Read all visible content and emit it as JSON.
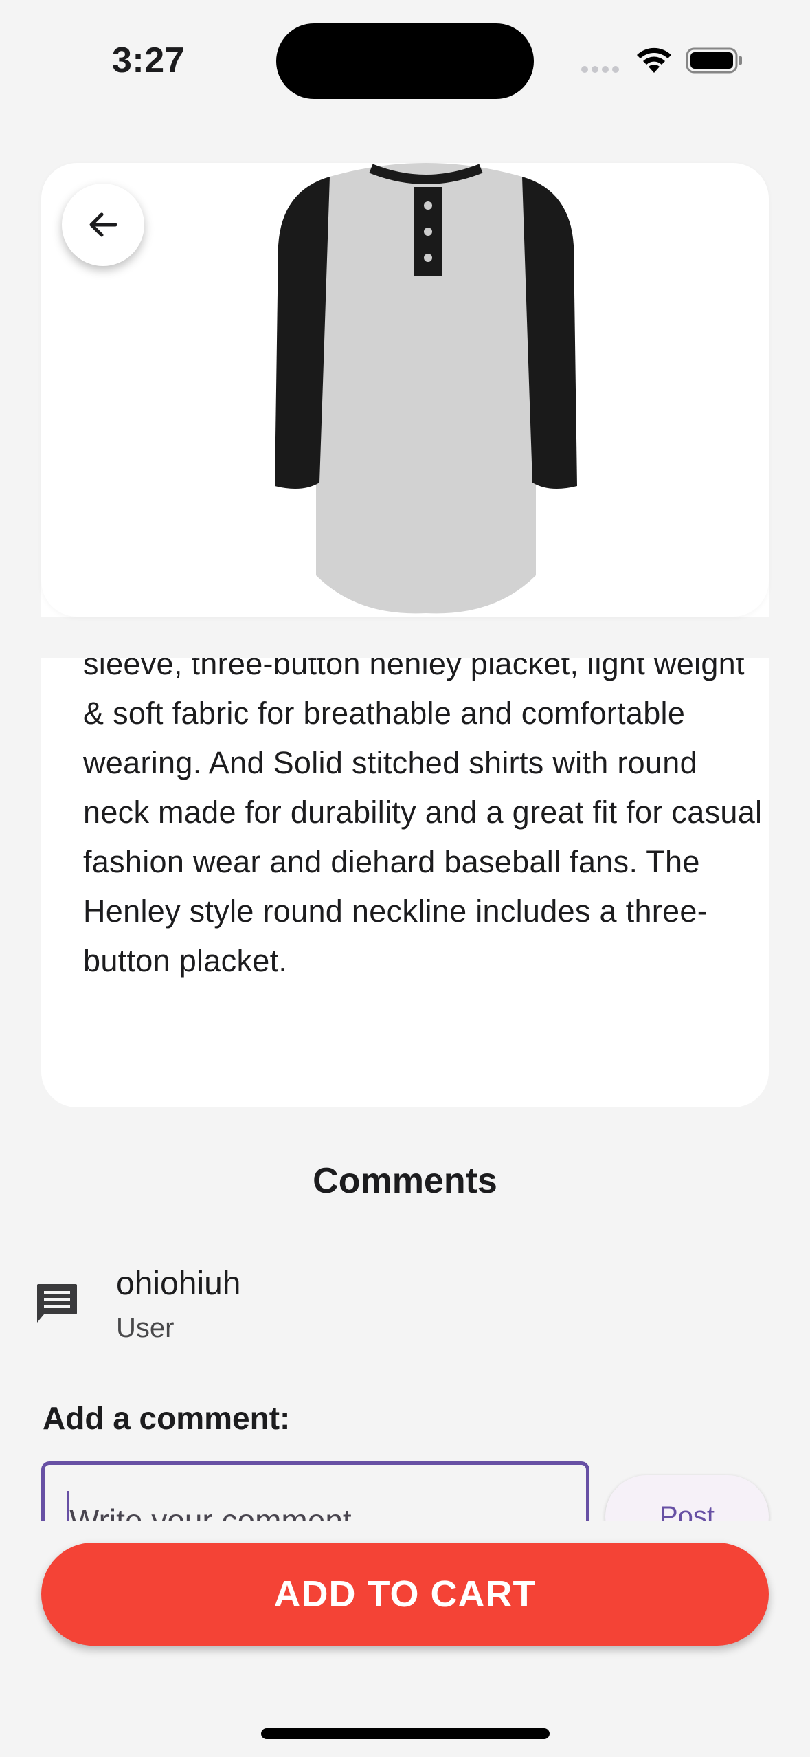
{
  "status_bar": {
    "time": "3:27"
  },
  "product": {
    "image_alt": "Henley raglan shirt",
    "description": "sleeve, three-button henley placket, light weight & soft fabric for breathable and comfortable wearing. And Solid stitched shirts with round neck made for durability and a great fit for casual fashion wear and diehard baseball fans. The Henley style round neckline includes a three-button placket."
  },
  "comments": {
    "heading": "Comments",
    "items": [
      {
        "text": "ohiohiuh",
        "author": "User"
      }
    ],
    "add_label": "Add a comment:",
    "input_placeholder": "Write your comment",
    "post_label": "Post"
  },
  "cart": {
    "button_label": "ADD TO CART"
  },
  "colors": {
    "accent": "#6750a4",
    "cart": "#f44336",
    "background": "#f4f4f4"
  }
}
